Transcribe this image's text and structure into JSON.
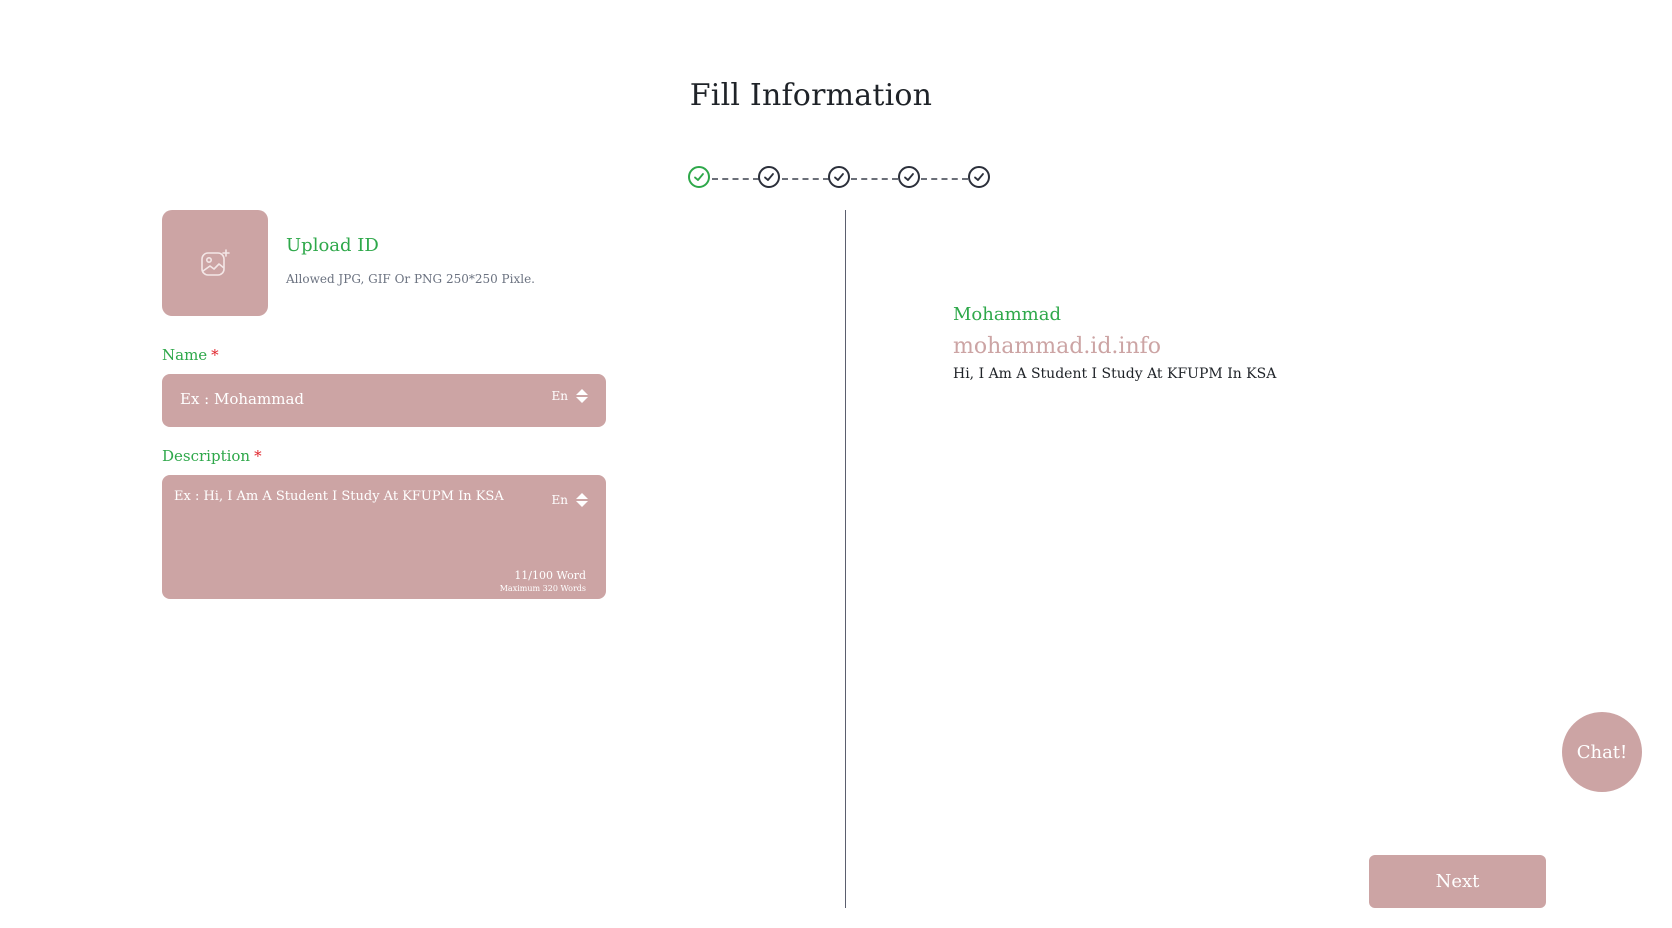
{
  "page": {
    "title": "Fill Information"
  },
  "stepper": {
    "steps": [
      {
        "state": "active"
      },
      {
        "state": "complete"
      },
      {
        "state": "complete"
      },
      {
        "state": "complete"
      },
      {
        "state": "complete"
      }
    ],
    "colors": {
      "active": "#2ea84a",
      "complete": "#2b2f3a"
    }
  },
  "upload": {
    "title": "Upload ID",
    "hint": "Allowed JPG, GIF Or PNG 250*250 Pixle."
  },
  "form": {
    "name": {
      "label": "Name",
      "required_mark": "*",
      "placeholder": "Ex : Mohammad",
      "lang": "En"
    },
    "description": {
      "label": "Description",
      "required_mark": "*",
      "placeholder": "Ex : Hi, I Am A Student I Study At KFUPM In KSA",
      "lang": "En",
      "word_count": "11/100 Word",
      "max_words": "Maximum 320 Words"
    }
  },
  "preview": {
    "name": "Mohammad",
    "link": "mohammad.id.info",
    "description": "Hi, I Am A Student I Study At KFUPM In KSA"
  },
  "actions": {
    "chat_label": "Chat!",
    "next_label": "Next"
  },
  "colors": {
    "accent_green": "#2ea84a",
    "rose": "#cca4a4",
    "required_red": "#e0242b"
  }
}
